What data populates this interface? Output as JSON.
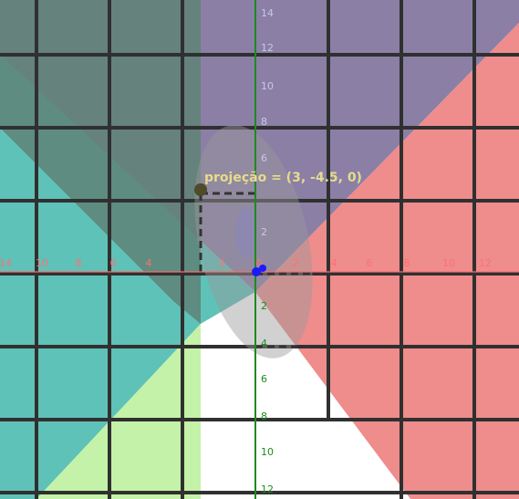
{
  "scene": {
    "label_text": "projeção = (3, -4.5, 0)",
    "colors": {
      "background": "#ffffff",
      "purple_plane": "#8b7fa6",
      "red_plane": "#ef8c8c",
      "teal_plane": "#5fc2b8",
      "green_plane": "#c4f2a8",
      "dark_overlay": "#5e8276",
      "ellipsoid": "#9a9a9a",
      "grid_line": "#303030",
      "axis_tick_red": "#ff7070",
      "axis_green": "#1e8a1e",
      "point_blue": "#1a1aff",
      "point_projection": "#4f4a2a",
      "label": "#e6dc8a"
    },
    "horizontal_axis": {
      "labels": [
        "14",
        "10",
        "8",
        "6",
        "4",
        "2",
        "0",
        "2",
        "4",
        "6",
        "8",
        "10",
        "12"
      ]
    },
    "vertical_axis": {
      "labels": [
        "14",
        "12",
        "10",
        "8",
        "6",
        "2",
        "2",
        "4",
        "6",
        "8",
        "10",
        "12"
      ]
    }
  }
}
